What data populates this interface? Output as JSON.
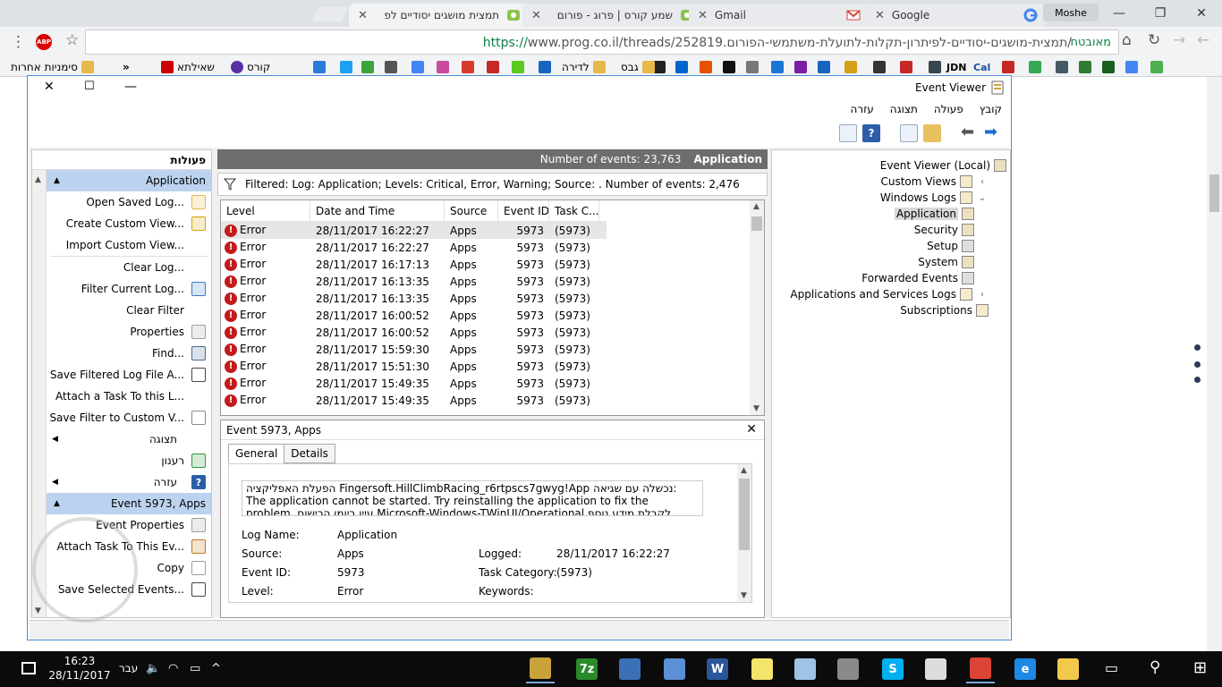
{
  "browser": {
    "tabs": [
      {
        "title": "תמצית מושגים יסודיים לפ",
        "active": true,
        "icon": "prog-icon"
      },
      {
        "title": "שמע קורס | פרוג - פורום",
        "active": false,
        "icon": "prog-icon"
      },
      {
        "title": "Gmail",
        "active": false,
        "icon": "gmail-icon"
      },
      {
        "title": "Google",
        "active": false,
        "icon": "google-icon"
      }
    ],
    "profile_name": "Moshe",
    "url": {
      "scheme": "https://",
      "host": "www.prog.co.il",
      "path": "/threads/252819.תמצית-מושגים-יסודיים-לפיתרון-תקלות-לתועלת-משתמשי-הפורום/"
    },
    "secure_label": "מאובטח",
    "abp_label": "ABP",
    "bookmarks": [
      {
        "label": "סימניות אחרות",
        "color": "#e8b84a"
      },
      {
        "label": "»",
        "color": ""
      },
      {
        "label": "שאילתא",
        "color": "#cc0000"
      },
      {
        "label": "קורס",
        "color": "#5a2ea6"
      },
      {
        "label": "לדירה",
        "color": "#e8b84a"
      },
      {
        "label": "גבס",
        "color": "#e8b84a"
      }
    ],
    "bookmark_icon_colors": [
      "#2a7bd6",
      "#1da1f2",
      "#3aa53a",
      "#555",
      "#4285f4",
      "#c94ba0",
      "#d83b2a",
      "#c62828",
      "#5ac81e",
      "#1565c0",
      "#222",
      "#0066cc",
      "#e65100",
      "#111",
      "#777",
      "#1976d2",
      "#7b1fa2",
      "#1565c0",
      "#d4a017",
      "#333",
      "#c62828",
      "#37474f",
      "#c62828",
      "#34a853",
      "#455a64",
      "#2e7d32",
      "#1b5e20",
      "#4285f4",
      "#4caf50"
    ],
    "bookmark_text_icons": [
      "JDN",
      "Cal"
    ]
  },
  "event_viewer": {
    "title": "Event Viewer",
    "menu": [
      "קובץ",
      "פעולה",
      "תצוגה",
      "עזרה"
    ],
    "actions_title": "פעולות",
    "actions": [
      {
        "type": "section",
        "label": "Application"
      },
      {
        "type": "item",
        "label": "Open Saved Log...",
        "icon": "folder-open-icon",
        "color": "#e8b84a"
      },
      {
        "type": "item",
        "label": "Create Custom View...",
        "icon": "filter-icon",
        "color": "#d9a400"
      },
      {
        "type": "item",
        "label": "Import Custom View...",
        "icon": "",
        "color": ""
      },
      {
        "type": "sep"
      },
      {
        "type": "item",
        "label": "Clear Log...",
        "icon": "",
        "color": ""
      },
      {
        "type": "item",
        "label": "Filter Current Log...",
        "icon": "filter-icon",
        "color": "#3b7bbf"
      },
      {
        "type": "item",
        "label": "Clear Filter",
        "icon": "",
        "color": ""
      },
      {
        "type": "item",
        "label": "Properties",
        "icon": "properties-icon",
        "color": "#9e9e9e"
      },
      {
        "type": "item",
        "label": "Find...",
        "icon": "binoculars-icon",
        "color": "#4a6a8a"
      },
      {
        "type": "item",
        "label": "Save Filtered Log File A...",
        "icon": "save-icon",
        "color": "#444"
      },
      {
        "type": "item",
        "label": "Attach a Task To this L...",
        "icon": "",
        "color": ""
      },
      {
        "type": "item",
        "label": "Save Filter to Custom V...",
        "icon": "filter-icon",
        "color": "#888"
      },
      {
        "type": "sub",
        "label": "תצוגה"
      },
      {
        "type": "item",
        "label": "רענון",
        "icon": "refresh-icon",
        "color": "#2e9a3a"
      },
      {
        "type": "sub",
        "label": "עזרה",
        "icon": "help-icon",
        "color": "#2c5ea8"
      },
      {
        "type": "section",
        "label": "Event 5973, Apps"
      },
      {
        "type": "item",
        "label": "Event Properties",
        "icon": "properties-icon",
        "color": "#9e9e9e"
      },
      {
        "type": "item",
        "label": "Attach Task To This Ev...",
        "icon": "clock-icon",
        "color": "#c07a1a"
      },
      {
        "type": "item",
        "label": "Copy",
        "icon": "copy-icon",
        "color": "#999"
      },
      {
        "type": "item",
        "label": "Save Selected Events...",
        "icon": "save-icon",
        "color": "#444"
      }
    ],
    "header": {
      "log_name": "Application",
      "count_label": "Number of events: 23,763"
    },
    "filter_text": "Filtered: Log: Application; Levels: Critical, Error, Warning; Source: . Number of events: 2,476",
    "columns": [
      "Level",
      "Date and Time",
      "Source",
      "Event ID",
      "Task C..."
    ],
    "events": [
      {
        "level": "Error",
        "date": "28/11/2017 16:22:27",
        "source": "Apps",
        "id": "5973",
        "task": "(5973)",
        "selected": true
      },
      {
        "level": "Error",
        "date": "28/11/2017 16:22:27",
        "source": "Apps",
        "id": "5973",
        "task": "(5973)"
      },
      {
        "level": "Error",
        "date": "28/11/2017 16:17:13",
        "source": "Apps",
        "id": "5973",
        "task": "(5973)"
      },
      {
        "level": "Error",
        "date": "28/11/2017 16:13:35",
        "source": "Apps",
        "id": "5973",
        "task": "(5973)"
      },
      {
        "level": "Error",
        "date": "28/11/2017 16:13:35",
        "source": "Apps",
        "id": "5973",
        "task": "(5973)"
      },
      {
        "level": "Error",
        "date": "28/11/2017 16:00:52",
        "source": "Apps",
        "id": "5973",
        "task": "(5973)"
      },
      {
        "level": "Error",
        "date": "28/11/2017 16:00:52",
        "source": "Apps",
        "id": "5973",
        "task": "(5973)"
      },
      {
        "level": "Error",
        "date": "28/11/2017 15:59:30",
        "source": "Apps",
        "id": "5973",
        "task": "(5973)"
      },
      {
        "level": "Error",
        "date": "28/11/2017 15:51:30",
        "source": "Apps",
        "id": "5973",
        "task": "(5973)"
      },
      {
        "level": "Error",
        "date": "28/11/2017 15:49:35",
        "source": "Apps",
        "id": "5973",
        "task": "(5973)"
      },
      {
        "level": "Error",
        "date": "28/11/2017 15:49:35",
        "source": "Apps",
        "id": "5973",
        "task": "(5973)"
      }
    ],
    "detail": {
      "title": "Event 5973, Apps",
      "tabs": [
        "General",
        "Details"
      ],
      "message": "הפעלת האפליקציה Fingersoft.HillClimbRacing_r6rtpscs7gwyg!App נכשלה עם שגיאה: The application cannot be started. Try reinstalling the application to fix the problem.  עיין ביומן הרישום Microsoft-Windows-TWinUI/Operational לקבלת מידע נוסף.",
      "fields": {
        "log_name_label": "Log Name:",
        "log_name": "Application",
        "source_label": "Source:",
        "source": "Apps",
        "logged_label": "Logged:",
        "logged": "28/11/2017 16:22:27",
        "event_id_label": "Event ID:",
        "event_id": "5973",
        "task_label": "Task Category:",
        "task": "(5973)",
        "level_label": "Level:",
        "level": "Error",
        "keywords_label": "Keywords:"
      }
    },
    "tree": [
      {
        "label": "Event Viewer (Local)",
        "caret": "",
        "selected": false,
        "color": "#c9a23a"
      },
      {
        "label": "Custom Views",
        "caret": "‹",
        "selected": false,
        "color": "#e8c060"
      },
      {
        "label": "Windows Logs",
        "caret": "⌄",
        "selected": false,
        "color": "#e8c060"
      },
      {
        "label": "Application",
        "caret": "",
        "selected": true,
        "color": "#c9a23a"
      },
      {
        "label": "Security",
        "caret": "",
        "selected": false,
        "color": "#c9a23a"
      },
      {
        "label": "Setup",
        "caret": "",
        "selected": false,
        "color": "#9e9e9e"
      },
      {
        "label": "System",
        "caret": "",
        "selected": false,
        "color": "#c9a23a"
      },
      {
        "label": "Forwarded Events",
        "caret": "",
        "selected": false,
        "color": "#9e9e9e"
      },
      {
        "label": "Applications and Services Logs",
        "caret": "‹",
        "selected": false,
        "color": "#e8c060"
      },
      {
        "label": "Subscriptions",
        "caret": "",
        "selected": false,
        "color": "#e8c060"
      }
    ]
  },
  "taskbar": {
    "time": "16:23",
    "date": "28/11/2017",
    "language": "עבר",
    "apps": [
      {
        "name": "event-viewer",
        "color": "#c9a23a",
        "running": true,
        "label": ""
      },
      {
        "name": "sevenzip",
        "color": "#2a8a2a",
        "running": false,
        "label": "7z"
      },
      {
        "name": "scanner",
        "color": "#3b6fb6",
        "running": false,
        "label": ""
      },
      {
        "name": "remote",
        "color": "#5b8fd6",
        "running": false,
        "label": ""
      },
      {
        "name": "word",
        "color": "#2b579a",
        "running": false,
        "label": "W"
      },
      {
        "name": "sticky-notes",
        "color": "#f3e46b",
        "running": false,
        "label": ""
      },
      {
        "name": "notepad",
        "color": "#9ec3e6",
        "running": false,
        "label": ""
      },
      {
        "name": "calculator",
        "color": "#8a8a8a",
        "running": false,
        "label": ""
      },
      {
        "name": "skype",
        "color": "#00aff0",
        "running": false,
        "label": "S"
      },
      {
        "name": "store",
        "color": "#dddddd",
        "running": false,
        "label": ""
      },
      {
        "name": "chrome",
        "color": "#db4437",
        "running": true,
        "label": ""
      },
      {
        "name": "edge",
        "color": "#1e88e5",
        "running": false,
        "label": "e"
      },
      {
        "name": "explorer",
        "color": "#f2c94c",
        "running": false,
        "label": ""
      }
    ]
  }
}
